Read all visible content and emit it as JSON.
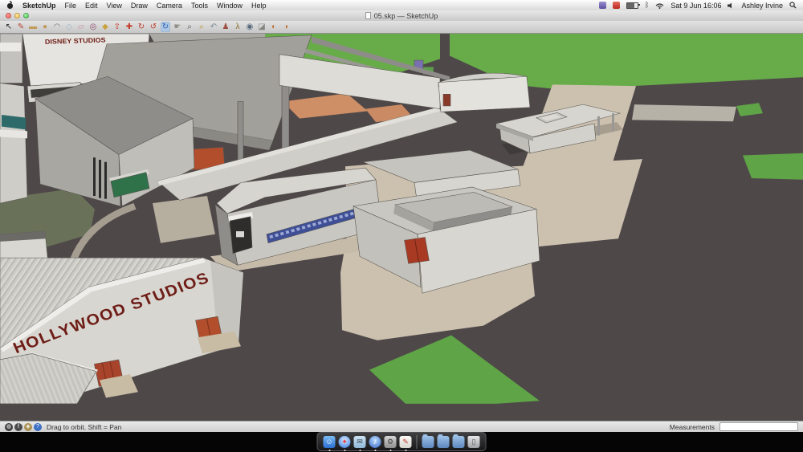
{
  "menubar": {
    "app_name": "SketchUp",
    "items": [
      "File",
      "Edit",
      "View",
      "Draw",
      "Camera",
      "Tools",
      "Window",
      "Help"
    ],
    "status": {
      "datetime": "Sat 9 Jun 16:06",
      "user": "Ashley Irvine"
    }
  },
  "window": {
    "title": "05.skp — SketchUp"
  },
  "toolbar": {
    "tools": [
      {
        "name": "select-tool",
        "glyph": "↖",
        "color": "#1d1d1d",
        "selected": false
      },
      {
        "name": "line-tool",
        "glyph": "✎",
        "color": "#b5432f",
        "selected": false
      },
      {
        "name": "rectangle-tool",
        "glyph": "▬",
        "color": "#c19a5c",
        "selected": false
      },
      {
        "name": "circle-tool",
        "glyph": "●",
        "color": "#c19a5c",
        "selected": false
      },
      {
        "name": "arc-tool",
        "glyph": "◠",
        "color": "#77756f",
        "selected": false
      },
      {
        "name": "polygon-tool",
        "glyph": "◇",
        "color": "#9db3c9",
        "selected": false
      },
      {
        "name": "eraser-tool",
        "glyph": "▱",
        "color": "#c98fa0",
        "selected": false
      },
      {
        "name": "tape-measure-tool",
        "glyph": "◎",
        "color": "#8c4a6e",
        "selected": false
      },
      {
        "name": "paint-bucket-tool",
        "glyph": "◆",
        "color": "#c9a23f",
        "selected": false
      },
      {
        "name": "push-pull-tool",
        "glyph": "⇧",
        "color": "#c23b2a",
        "selected": false
      },
      {
        "name": "move-tool",
        "glyph": "✚",
        "color": "#c23b2a",
        "selected": false
      },
      {
        "name": "rotate-tool",
        "glyph": "↻",
        "color": "#c23b2a",
        "selected": false
      },
      {
        "name": "offset-tool",
        "glyph": "↺",
        "color": "#c23b2a",
        "selected": false
      },
      {
        "name": "orbit-tool",
        "glyph": "↻",
        "color": "#2f62b5",
        "selected": true
      },
      {
        "name": "pan-tool",
        "glyph": "☛",
        "color": "#8f8d88",
        "selected": false
      },
      {
        "name": "zoom-tool",
        "glyph": "⌕",
        "color": "#4f4f4f",
        "selected": false
      },
      {
        "name": "zoom-extents-tool",
        "glyph": "⌕",
        "color": "#b8952f",
        "selected": false
      },
      {
        "name": "previous-view-tool",
        "glyph": "↶",
        "color": "#7a8a99",
        "selected": false
      },
      {
        "name": "position-camera-tool",
        "glyph": "♟",
        "color": "#9c4f42",
        "selected": false
      },
      {
        "name": "walk-tool",
        "glyph": "λ",
        "color": "#8a6a2a",
        "selected": false
      },
      {
        "name": "look-around-tool",
        "glyph": "◉",
        "color": "#55667a",
        "selected": false
      },
      {
        "name": "section-plane-tool",
        "glyph": "◪",
        "color": "#87857f",
        "selected": false
      },
      {
        "name": "shadows-tool",
        "glyph": "◐",
        "color": "#c0763a",
        "selected": false
      },
      {
        "name": "fog-tool",
        "glyph": "◑",
        "color": "#c0763a",
        "selected": false
      }
    ]
  },
  "viewport": {
    "signs": {
      "hollywood": "HOLLYWOOD STUDIOS",
      "disney": "DISNEY STUDIOS"
    },
    "palette": {
      "road": "#4E4849",
      "grass": "#68AC4A",
      "grass_dark": "#5FA446",
      "olive_lawn": "#6A7159",
      "walkway": "#CCC1AF",
      "concrete": "#B7B2A8",
      "building_light": "#D8D6D1",
      "building_mid": "#C0BEB9",
      "building_dark": "#8F8D89",
      "salmon": "#CE8E66",
      "yellow_wall": "#D5C97D",
      "sign_red": "#6E1D16",
      "door_red": "#A83A24",
      "door_orange": "#B24E2C",
      "blue_sign": "#3F4F96",
      "marquee_green": "#2F7148"
    }
  },
  "statusbar": {
    "icons": [
      {
        "name": "geolocation-icon",
        "glyph": "◍",
        "bg": "#3e3e3e"
      },
      {
        "name": "credit-icon",
        "glyph": "f",
        "bg": "#4a4a4a"
      },
      {
        "name": "claim-icon",
        "glyph": "◈",
        "bg": "#a98f52"
      },
      {
        "name": "help-icon",
        "glyph": "?",
        "bg": "#3b6fc4"
      }
    ],
    "hint": "Drag to orbit.  Shift = Pan",
    "measurements_label": "Measurements",
    "measurements_value": ""
  },
  "dock": {
    "items": [
      {
        "name": "finder-icon",
        "type": "app",
        "glyph": "☺",
        "running": true
      },
      {
        "name": "safari-icon",
        "type": "app",
        "glyph": "✦",
        "running": true
      },
      {
        "name": "mail-icon",
        "type": "app",
        "glyph": "✉",
        "running": true
      },
      {
        "name": "itunes-icon",
        "type": "app",
        "glyph": "♪",
        "running": true
      },
      {
        "name": "system-preferences-icon",
        "type": "app",
        "glyph": "⚙",
        "running": true
      },
      {
        "name": "sketchup-dock-icon",
        "type": "app",
        "glyph": "✎",
        "running": true
      },
      {
        "name": "dock-separator",
        "type": "separator",
        "glyph": "",
        "running": false
      },
      {
        "name": "folder-documents-icon",
        "type": "folder",
        "glyph": "",
        "running": false
      },
      {
        "name": "folder-downloads-icon",
        "type": "folder",
        "glyph": "",
        "running": false
      },
      {
        "name": "folder-applications-icon",
        "type": "folder",
        "glyph": "",
        "running": false
      },
      {
        "name": "trash-icon",
        "type": "trash",
        "glyph": "▯",
        "running": false
      }
    ]
  }
}
